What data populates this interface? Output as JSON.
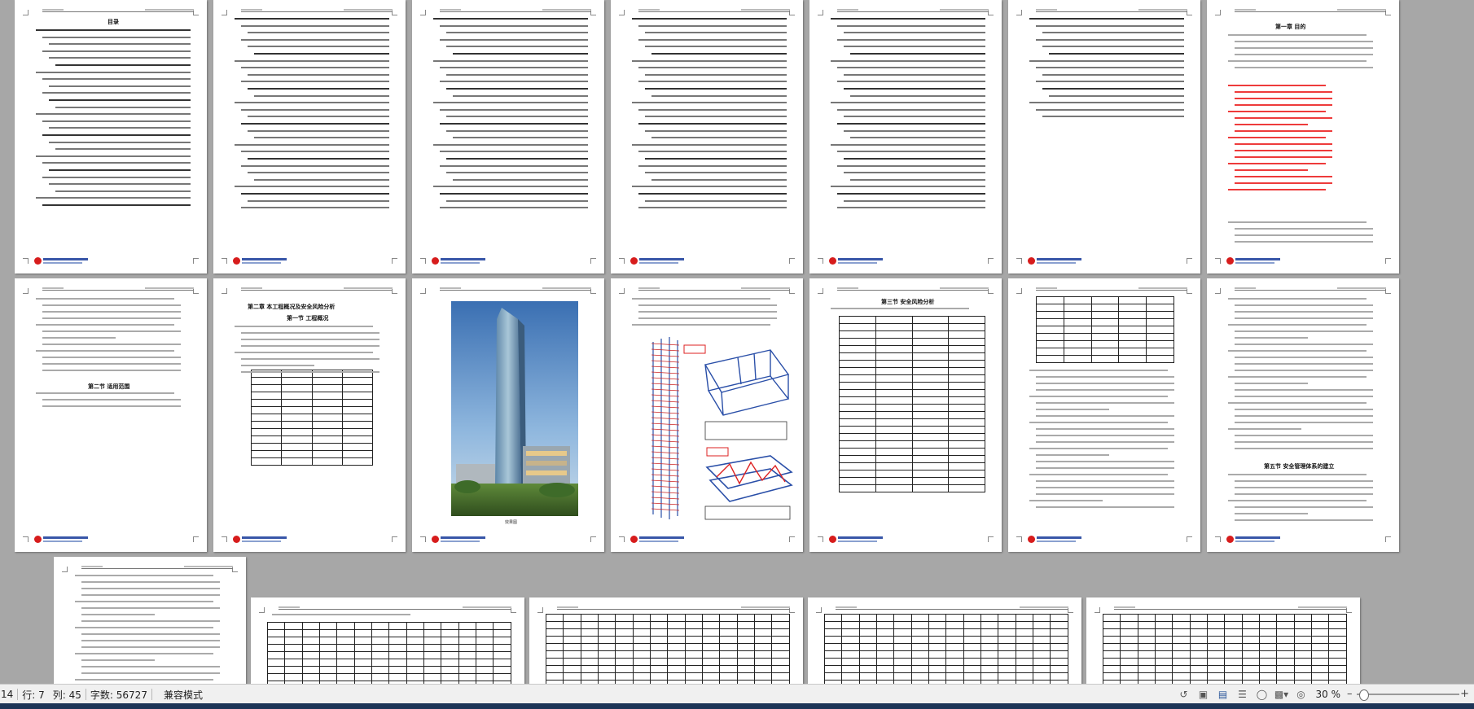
{
  "toc_title": "目录",
  "chapter1_title": "第一章  目的",
  "chapter2_title": "第二章  本工程概况及安全风险分析",
  "chapter2_section1": "第一节  工程概况",
  "section_scope": "第二节  适用范围",
  "section_risk": "第三节  安全风险分析",
  "section_manage": "第五节  安全管理体系的建立",
  "building_caption": "效果图",
  "statusbar": {
    "page": "14",
    "row": "行: 7",
    "col": "列: 45",
    "words": "字数: 56727",
    "mode": "兼容模式",
    "zoom": "30 %"
  },
  "zoom_percent": 30
}
